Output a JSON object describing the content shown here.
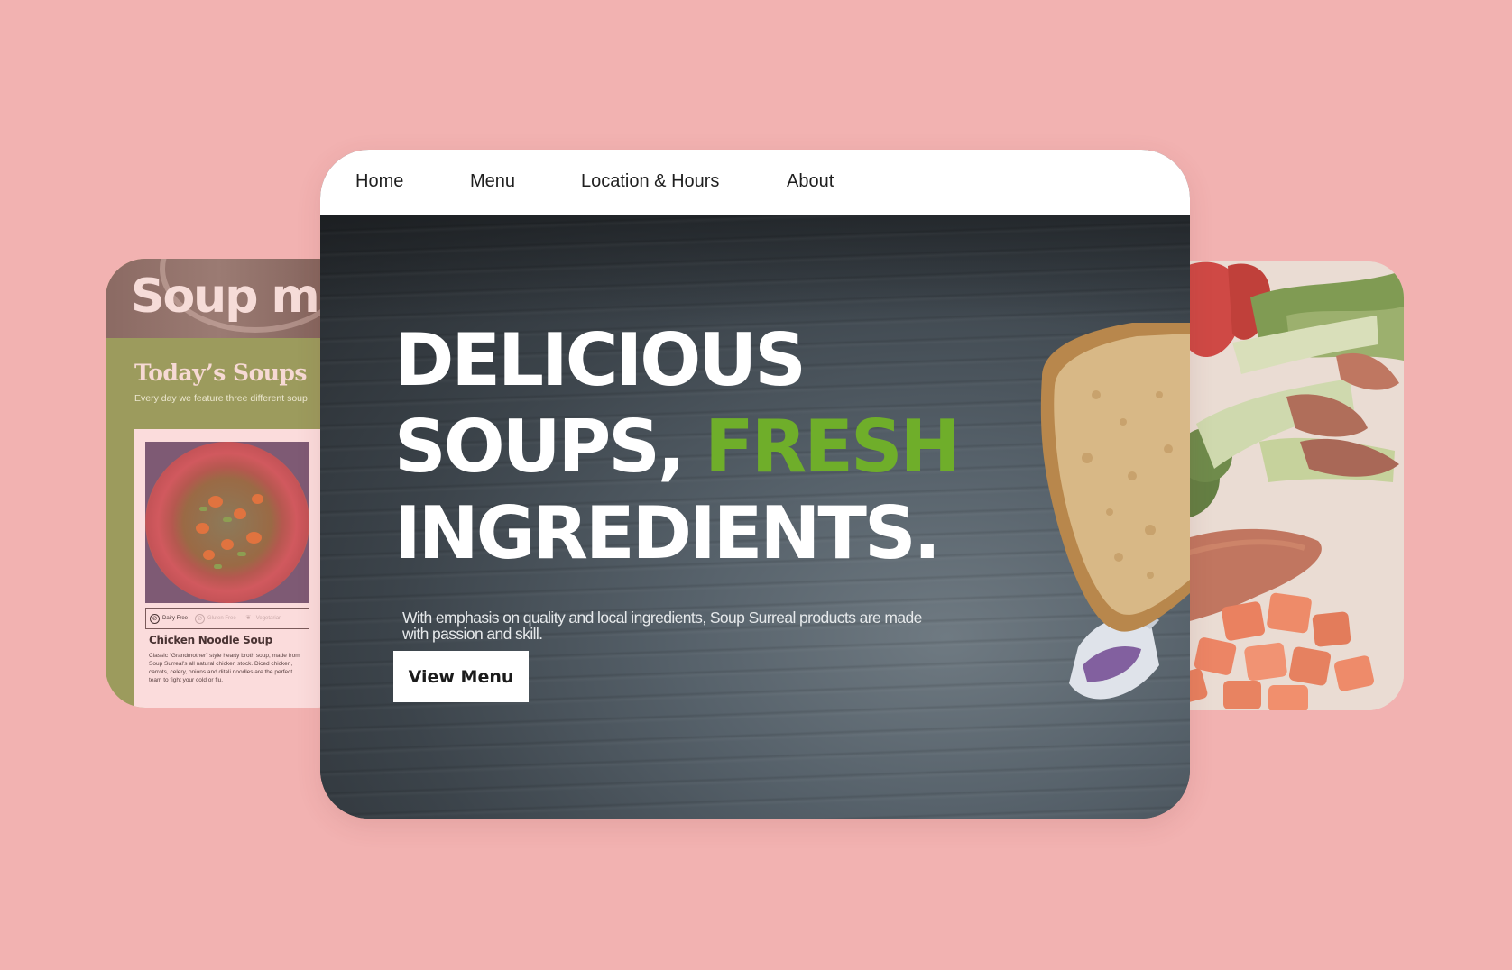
{
  "left_card": {
    "title": "Soup me",
    "section_title": "Today’s Soups",
    "section_subtitle": "Every day we feature three different soup",
    "soup": {
      "name": "Chicken Noodle Soup",
      "description": "Classic “Grandmother” style hearty broth soup, made from Soup Surreal’s all natural chicken stock. Diced chicken, carrots, celery, onions and ditali noodles are the perfect team to fight your cold or flu.",
      "diet_tags": [
        {
          "label": "Dairy Free",
          "icon": "dairy-free-icon",
          "active": true
        },
        {
          "label": "Gluten Free",
          "icon": "gluten-free-icon",
          "active": false
        },
        {
          "label": "Vegetarian",
          "icon": "leaf-icon",
          "active": false
        }
      ]
    }
  },
  "main_card": {
    "nav": {
      "items": [
        {
          "label": "Home"
        },
        {
          "label": "Menu"
        },
        {
          "label": "Location & Hours"
        },
        {
          "label": "About"
        }
      ]
    },
    "hero": {
      "headline_line1": "DELICIOUS",
      "headline_line2_prefix": "SOUPS, ",
      "headline_line2_accent": "FRESH",
      "headline_line3": "INGREDIENTS.",
      "subtitle": "With emphasis on quality and local ingredients, Soup Surreal products are made with passion and skill.",
      "cta_label": "View Menu"
    }
  },
  "colors": {
    "background": "#f2b2b1",
    "accent_green": "#6fae2a",
    "left_card_olive": "#9c9b5d",
    "soup_card_pink": "#fbdcdc"
  }
}
